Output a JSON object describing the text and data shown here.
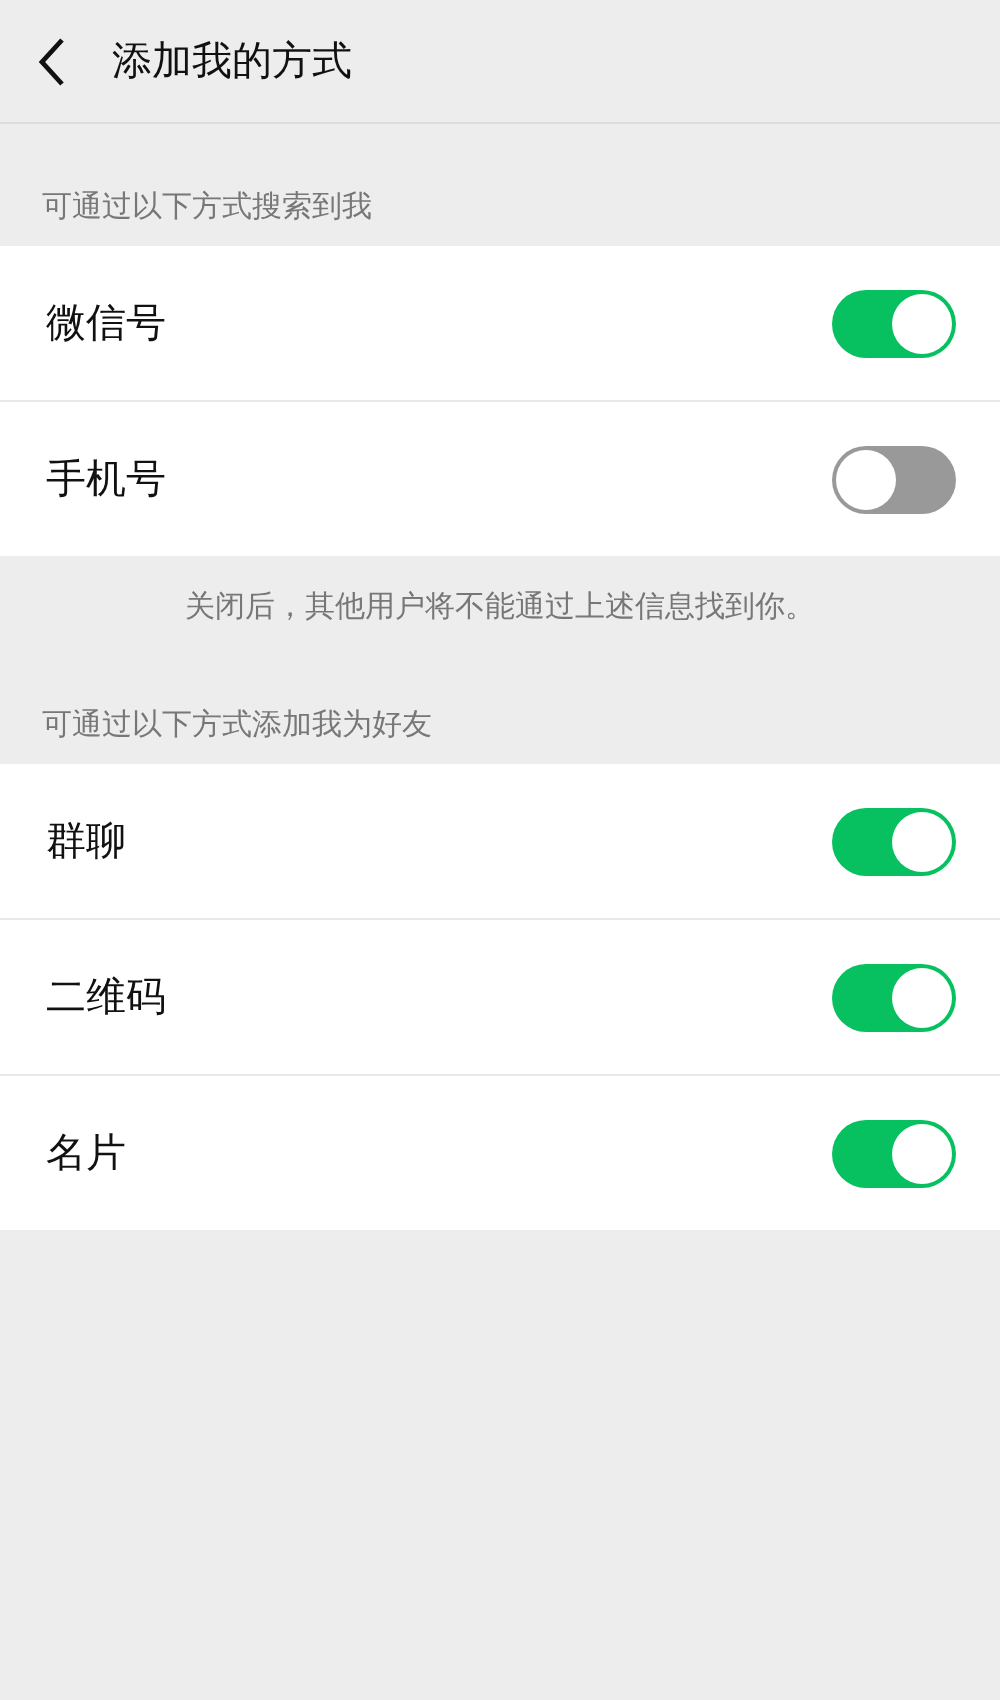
{
  "header": {
    "title": "添加我的方式"
  },
  "sections": [
    {
      "label": "可通过以下方式搜索到我",
      "items": [
        {
          "label": "微信号",
          "on": true
        },
        {
          "label": "手机号",
          "on": false
        }
      ],
      "note": "关闭后，其他用户将不能通过上述信息找到你。"
    },
    {
      "label": "可通过以下方式添加我为好友",
      "items": [
        {
          "label": "群聊",
          "on": true
        },
        {
          "label": "二维码",
          "on": true
        },
        {
          "label": "名片",
          "on": true
        }
      ]
    }
  ]
}
